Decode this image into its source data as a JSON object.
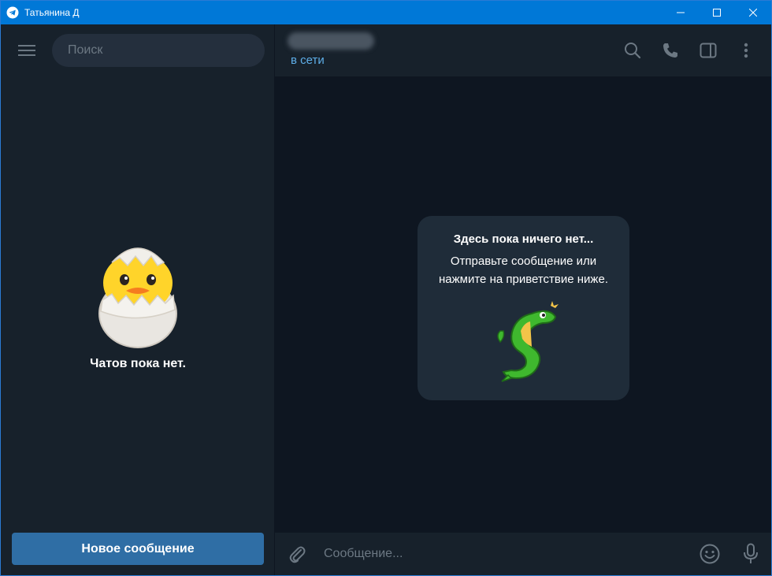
{
  "window": {
    "title": "Татьянина Д"
  },
  "sidebar": {
    "search_placeholder": "Поиск",
    "empty_label": "Чатов пока нет.",
    "new_message_label": "Новое сообщение"
  },
  "chat": {
    "status": "в сети",
    "empty_title": "Здесь пока ничего нет...",
    "empty_text": "Отправьте сообщение или нажмите на приветствие ниже.",
    "input_placeholder": "Сообщение..."
  },
  "icons": {
    "app": "telegram-icon",
    "minimize": "minimize-icon",
    "maximize": "maximize-icon",
    "close": "close-icon",
    "menu": "hamburger-icon",
    "search": "search-icon",
    "call": "phone-icon",
    "sidebar_toggle": "sidebar-icon",
    "more": "more-vertical-icon",
    "attach": "paperclip-icon",
    "emoji": "smile-icon",
    "mic": "microphone-icon"
  },
  "colors": {
    "titlebar": "#0078d7",
    "sidebar_bg": "#17212b",
    "chat_bg": "#0e1621",
    "accent": "#2f6ea5",
    "status": "#5eaee8"
  }
}
